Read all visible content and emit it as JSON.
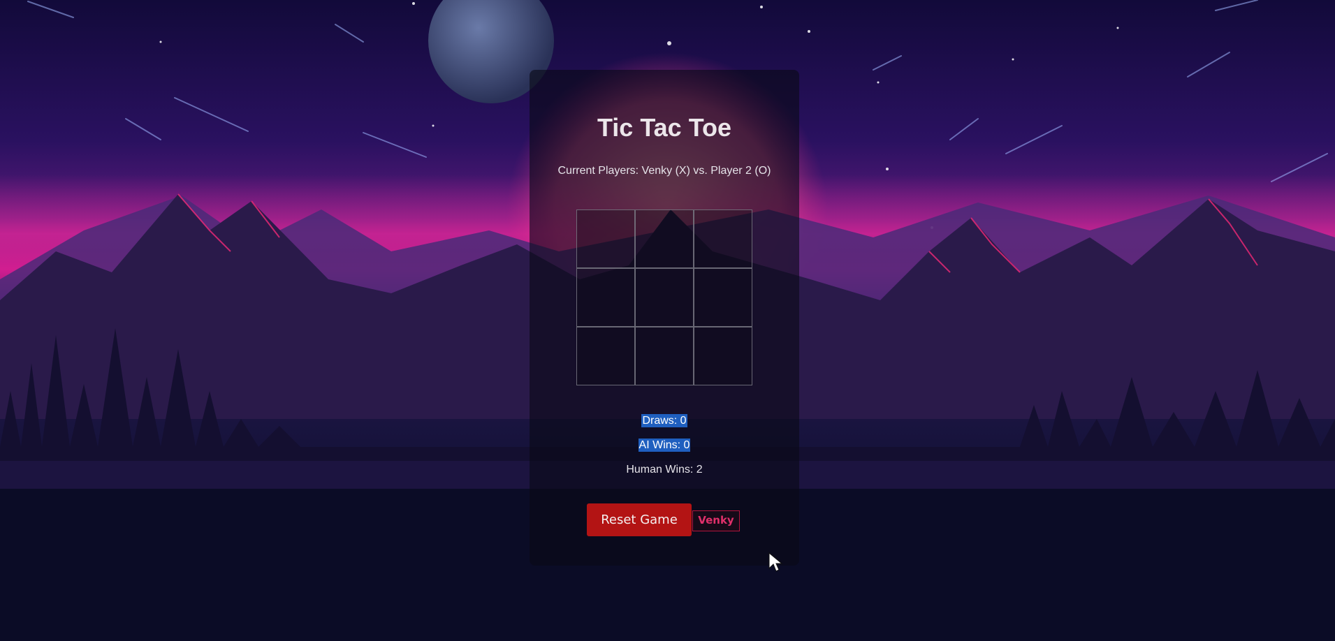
{
  "game": {
    "title": "Tic Tac Toe",
    "players_text": "Current Players: Venky (X) vs. Player 2 (O)",
    "board": [
      "",
      "",
      "",
      "",
      "",
      "",
      "",
      "",
      ""
    ]
  },
  "stats": {
    "draws": "Draws: 0",
    "ai_wins": "AI Wins: 0",
    "human_wins": "Human Wins: 2"
  },
  "controls": {
    "reset_label": "Reset Game",
    "player_name": "Venky"
  },
  "colors": {
    "reset_button": "#b31414",
    "name_tag": "#e0306a",
    "selection_highlight": "#1f5fbf"
  }
}
